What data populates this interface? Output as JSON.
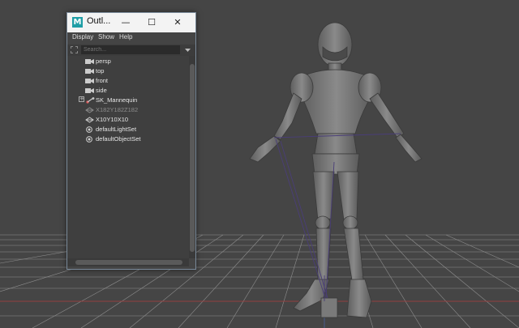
{
  "window": {
    "title": "Outl...",
    "app_icon_letter": "M",
    "minimize_glyph": "—",
    "maximize_glyph": "☐",
    "close_glyph": "✕"
  },
  "menu": {
    "items": [
      "Display",
      "Show",
      "Help"
    ]
  },
  "search": {
    "placeholder": "Search..."
  },
  "outliner": {
    "items": [
      {
        "label": "persp",
        "icon": "camera-icon"
      },
      {
        "label": "top",
        "icon": "camera-icon"
      },
      {
        "label": "front",
        "icon": "camera-icon"
      },
      {
        "label": "side",
        "icon": "camera-icon"
      },
      {
        "label": "SK_Mannequin",
        "icon": "skeleton-icon",
        "expandable": true
      },
      {
        "label": "X182Y182Z182",
        "icon": "locator-icon",
        "dimmed": true
      },
      {
        "label": "X10Y10X10",
        "icon": "locator-icon"
      },
      {
        "label": "defaultLightSet",
        "icon": "set-icon"
      },
      {
        "label": "defaultObjectSet",
        "icon": "set-icon"
      }
    ]
  },
  "colors": {
    "viewport_bg": "#454545",
    "panel_bg": "#444444",
    "title_bar": "#f3f3f3",
    "accent": "#1f9ea6"
  }
}
